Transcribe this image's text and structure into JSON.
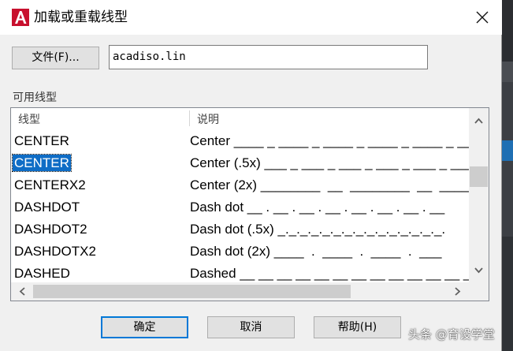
{
  "dialog": {
    "title": "加载或重载线型",
    "app_icon": "autocad-icon",
    "close_icon": "close-icon"
  },
  "file": {
    "button_label": "文件(F)...",
    "value": "acadiso.lin"
  },
  "available": {
    "label": "可用线型",
    "columns": [
      "线型",
      "说明"
    ],
    "rows": [
      {
        "name": "CENTER",
        "desc": "Center ____ _ ____ _ ____ _ ____ _ ____ _ ____"
      },
      {
        "name": "CENTER",
        "desc": "Center (.5x) ___ _ ___ _ ___ _ ___ _ ___ _ ___",
        "selected": true
      },
      {
        "name": "CENTERX2",
        "desc": "Center (2x) ________  __  ________  __  _____"
      },
      {
        "name": "DASHDOT",
        "desc": "Dash dot __ . __ . __ . __ . __ . __ . __ . __"
      },
      {
        "name": "DASHDOT2",
        "desc": "Dash dot (.5x) _._._._._._._._._._._._._._._."
      },
      {
        "name": "DASHDOTX2",
        "desc": "Dash dot (2x) ____  .  ____  .  ____  .  ___"
      },
      {
        "name": "DASHED",
        "desc": "Dashed __ __ __ __ __ __ __ __ __ __ __ __ __ _"
      }
    ]
  },
  "buttons": {
    "ok": "确定",
    "cancel": "取消",
    "help": "帮助(H)"
  },
  "watermark": "头条 @育设学堂",
  "colors": {
    "selection": "#0f6dc6",
    "default_button_border": "#0078d7",
    "autocad_red": "#c8102e"
  }
}
